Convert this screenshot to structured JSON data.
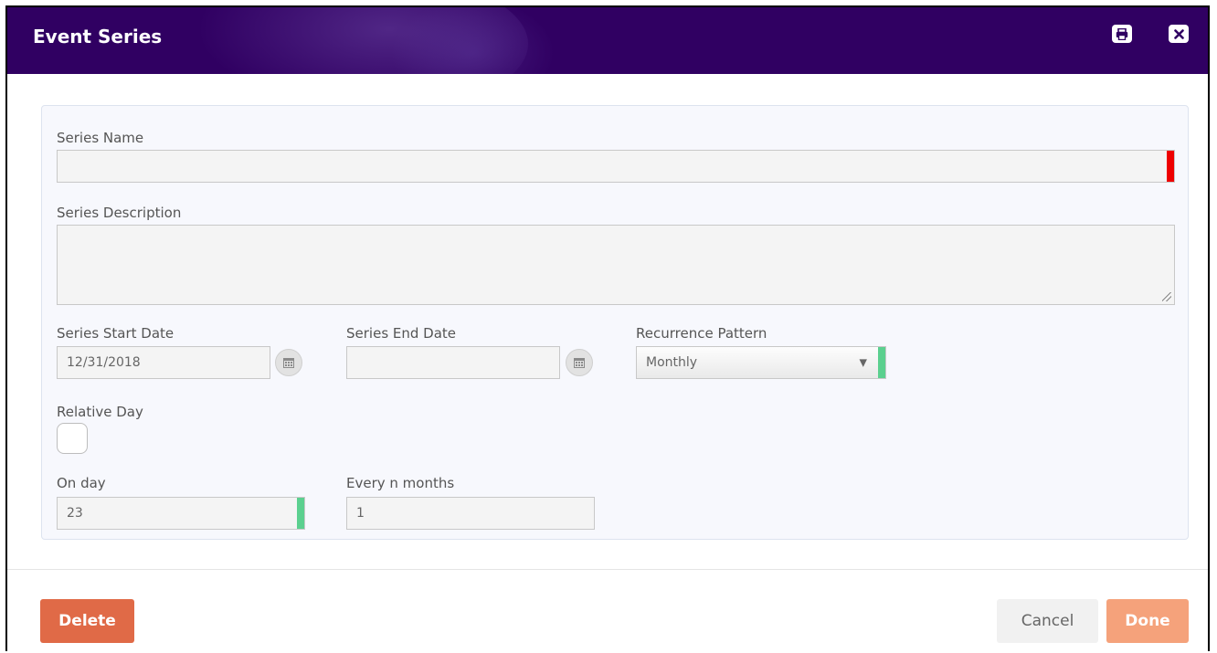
{
  "dialog": {
    "title": "Event Series",
    "print_icon": "print-icon",
    "close_icon": "close-icon",
    "header_color": "#300062"
  },
  "form": {
    "series_name": {
      "label": "Series Name",
      "value": "",
      "required_color": "#ee0000"
    },
    "series_description": {
      "label": "Series Description",
      "value": ""
    },
    "series_start_date": {
      "label": "Series Start Date",
      "value": "12/31/2018",
      "icon": "calendar-icon"
    },
    "series_end_date": {
      "label": "Series End Date",
      "value": "",
      "icon": "calendar-icon"
    },
    "recurrence_pattern": {
      "label": "Recurrence Pattern",
      "value": "Monthly",
      "valid_color": "#5bd08f"
    },
    "relative_day": {
      "label": "Relative Day",
      "checked": false
    },
    "on_day": {
      "label": "On day",
      "value": "23"
    },
    "every_n_months": {
      "label": "Every n months",
      "value": "1"
    }
  },
  "footer": {
    "delete_label": "Delete",
    "cancel_label": "Cancel",
    "done_label": "Done",
    "delete_color": "#e06a47",
    "done_color": "#f5a27b"
  }
}
